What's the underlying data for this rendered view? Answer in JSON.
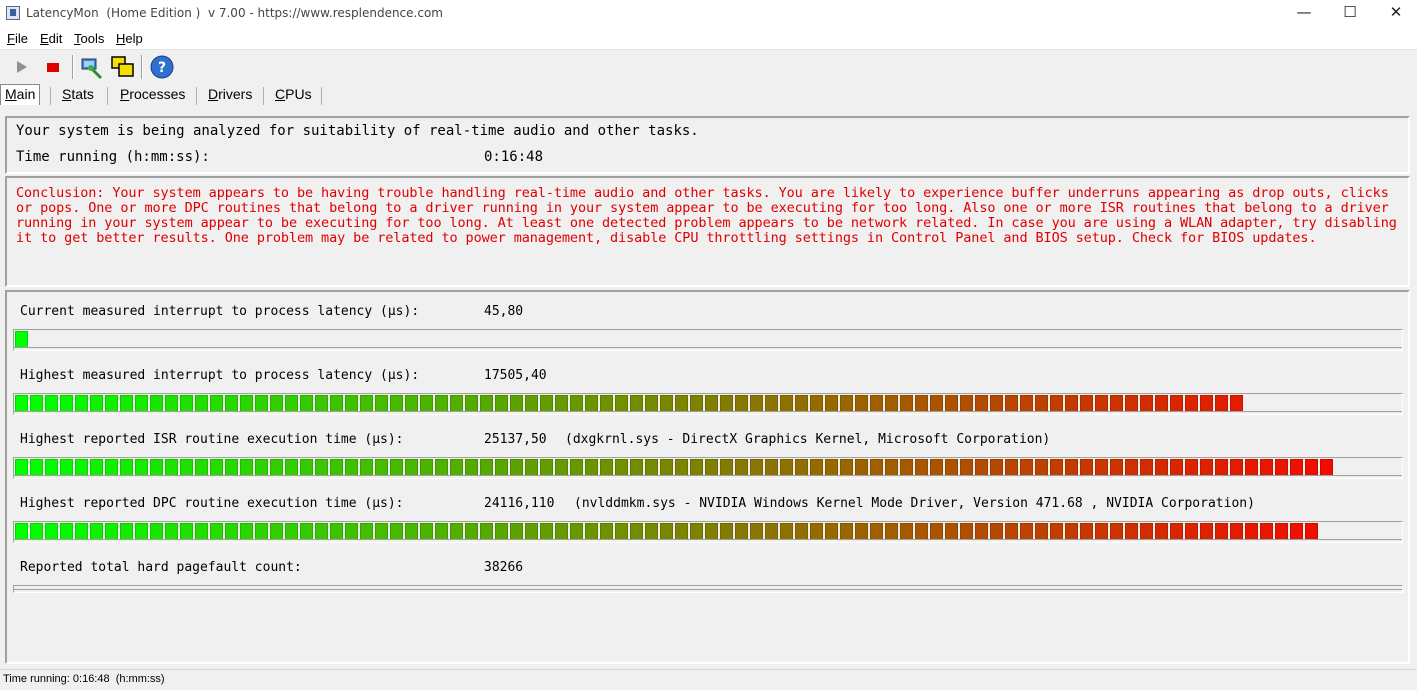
{
  "window": {
    "title": "LatencyMon  (Home Edition )  v 7.00 - https://www.resplendence.com",
    "minimize": "—",
    "maximize": "☐",
    "close": "✕"
  },
  "menu": [
    {
      "label": "File"
    },
    {
      "label": "Edit"
    },
    {
      "label": "Tools"
    },
    {
      "label": "Help"
    }
  ],
  "toolbar": {
    "icons": [
      "play-icon",
      "stop-icon",
      "driver-tool-icon",
      "windows-icon",
      "help-icon"
    ]
  },
  "tabs": [
    {
      "label": "Main",
      "active": true
    },
    {
      "label": "Stats"
    },
    {
      "label": "Processes"
    },
    {
      "label": "Drivers"
    },
    {
      "label": "CPUs"
    }
  ],
  "summary": {
    "line1": "Your system is being analyzed for suitability of real-time audio and other tasks.",
    "time_label": "Time running (h:mm:ss):",
    "time_value": "0:16:48"
  },
  "conclusion": "Conclusion: Your system appears to be having trouble handling real-time audio and other tasks. You are likely to experience buffer underruns appearing as drop outs, clicks or pops. One or more DPC routines that belong to a driver running in your system appear to be executing for too long. Also one or more ISR routines that belong to a driver running in your system appear to be executing for too long. At least one detected problem appears to be network related. In case you are using a WLAN adapter, try disabling it to get better results. One problem may be related to power management, disable CPU throttling settings in Control Panel and BIOS setup. Check for BIOS updates.",
  "metrics": [
    {
      "label": "Current measured interrupt to process latency (µs):",
      "value": "45,80",
      "detail": "",
      "segments": 1
    },
    {
      "label": "Highest measured interrupt to process latency (µs):",
      "value": "17505,40",
      "detail": "",
      "segments": 82
    },
    {
      "label": "Highest reported ISR routine execution time (µs):",
      "value": "25137,50",
      "detail": "(dxgkrnl.sys - DirectX Graphics Kernel, Microsoft Corporation)",
      "segments": 88
    },
    {
      "label": "Highest reported DPC routine execution time (µs):",
      "value": "24116,110",
      "detail": "(nvlddmkm.sys - NVIDIA Windows Kernel Mode Driver, Version 471.68 , NVIDIA Corporation)",
      "segments": 87
    },
    {
      "label": "Reported total hard pagefault count:",
      "value": "38266",
      "detail": "",
      "segments": 0
    }
  ],
  "bar_max_segments": 92,
  "colors": {
    "low": "#00ff00",
    "mid": "#808000",
    "high": "#ff0000"
  },
  "status": "Time running: 0:16:48  (h:mm:ss)"
}
